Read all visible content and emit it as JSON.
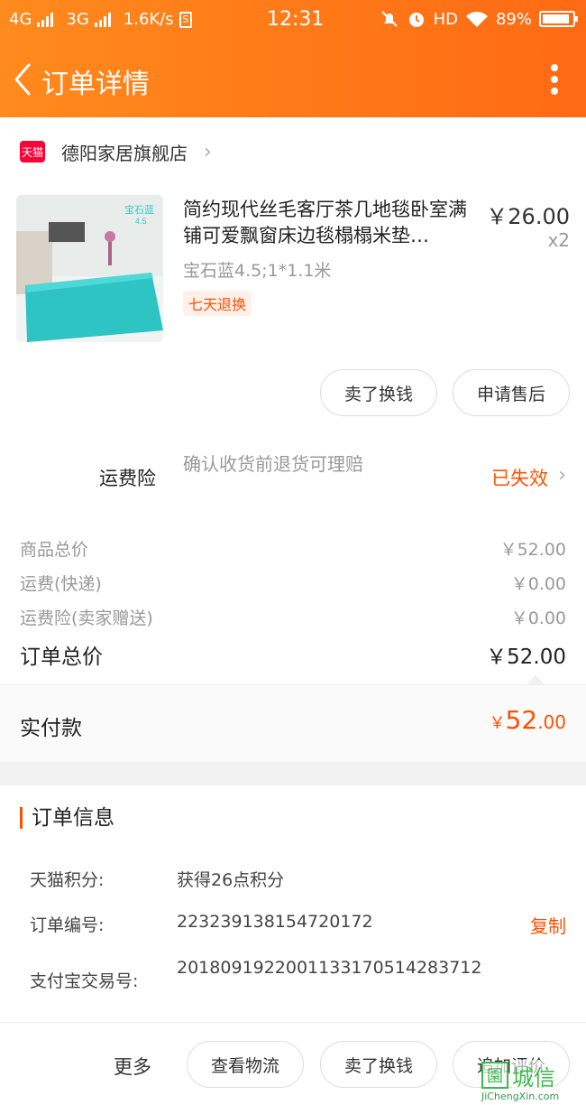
{
  "status_bar": {
    "network1": "4G",
    "network2": "3G",
    "speed": "1.6K/s",
    "time": "12:31",
    "hd": "HD",
    "battery": "89%"
  },
  "header": {
    "title": "订单详情"
  },
  "shop": {
    "badge": "天猫",
    "name": "德阳家居旗舰店"
  },
  "goods": {
    "title": "简约现代丝毛客厅茶几地毯卧室满铺可爱飘窗床边毯榻榻米垫…",
    "price": "￥26.00",
    "qty": "x2",
    "sku": "宝石蓝4.5;1*1.1米",
    "tag": "七天退换",
    "thumb_label": "宝石蓝",
    "thumb_sublabel": "4.5"
  },
  "item_actions": {
    "sell_label": "卖了换钱",
    "aftersale_label": "申请售后"
  },
  "insurance": {
    "label": "运费险",
    "description": "确认收货前退货可理赔",
    "status": "已失效",
    "status_color": "#ff5000"
  },
  "fees": [
    {
      "label": "商品总价",
      "value": "￥52.00"
    },
    {
      "label": "运费(快递)",
      "value": "￥0.00"
    },
    {
      "label": "运费险(卖家赠送)",
      "value": "￥0.00"
    }
  ],
  "order_total": {
    "label": "订单总价",
    "value": "￥52.00"
  },
  "paid": {
    "label": "实付款",
    "currency": "￥",
    "integer": "52",
    "decimal": ".00"
  },
  "order_info": {
    "title": "订单信息",
    "points_label": "天猫积分:",
    "points_value": "获得26点积分",
    "order_no_label": "订单编号:",
    "order_no_value": "223239138154720172",
    "copy_label": "复制",
    "trade_no_label": "支付宝交易号:",
    "trade_no_value": "2018091922001133170514283712"
  },
  "bottom_actions": {
    "more_label": "更多",
    "logistics_label": "查看物流",
    "sell_label": "卖了换钱",
    "review_label": "追加评价"
  },
  "watermark": {
    "logo_char": "園",
    "text": "城信",
    "url": "JiChengXin.com"
  },
  "colors": {
    "accent": "#ff5000",
    "header_gradient_start": "#ff8a1d",
    "header_gradient_end": "#ff6a14"
  }
}
